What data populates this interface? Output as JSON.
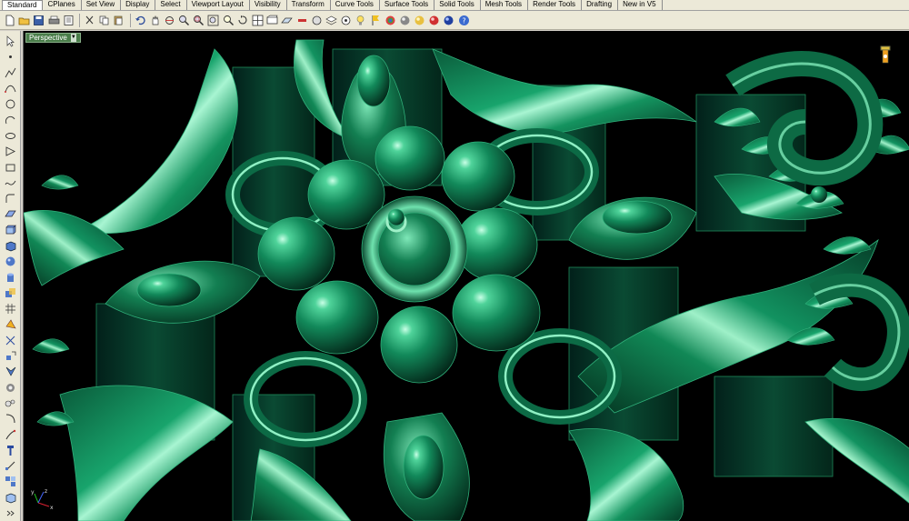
{
  "tabs": [
    {
      "label": "Standard",
      "active": true
    },
    {
      "label": "CPlanes"
    },
    {
      "label": "Set View"
    },
    {
      "label": "Display"
    },
    {
      "label": "Select"
    },
    {
      "label": "Viewport Layout"
    },
    {
      "label": "Visibility"
    },
    {
      "label": "Transform"
    },
    {
      "label": "Curve Tools"
    },
    {
      "label": "Surface Tools"
    },
    {
      "label": "Solid Tools"
    },
    {
      "label": "Mesh Tools"
    },
    {
      "label": "Render Tools"
    },
    {
      "label": "Drafting"
    },
    {
      "label": "New in V5"
    }
  ],
  "viewport": {
    "title": "Perspective",
    "axis": {
      "x": "x",
      "y": "y",
      "z": "z"
    }
  },
  "colors": {
    "model_base": "#0b5c3c",
    "model_mid": "#138a5a",
    "model_highlight": "#9ff0c8",
    "background": "#000000",
    "viewport_title_bg": "#4a7d4a"
  }
}
